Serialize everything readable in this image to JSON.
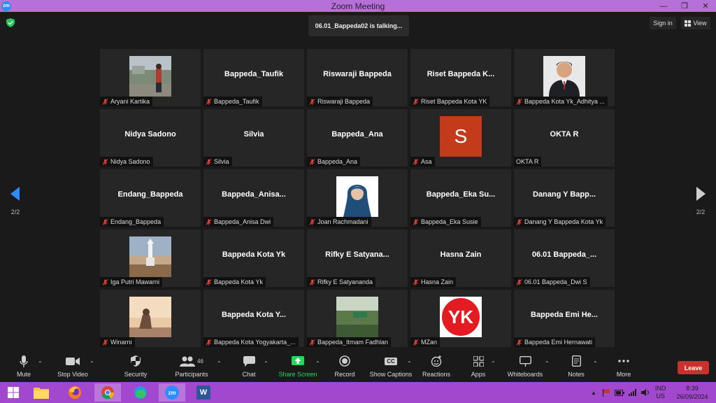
{
  "window": {
    "title": "Zoom Meeting",
    "app_icon": "zm"
  },
  "meeting": {
    "talking_indicator": "06.01_Bappeda02 is talking...",
    "sign_in_label": "Sign in",
    "view_label": "View",
    "page_indicator_left": "2/2",
    "page_indicator_right": "2/2"
  },
  "participants": [
    {
      "display": "photo",
      "label": "Aryani Kartika"
    },
    {
      "display": "name",
      "big_name": "Bappeda_Taufik",
      "label": "Bappeda_Taufik"
    },
    {
      "display": "name",
      "big_name": "Riswaraji Bappeda",
      "label": "Riswaraji Bappeda"
    },
    {
      "display": "name",
      "big_name": "Riset Bappeda K...",
      "label": "Riset Bappeda Kota YK"
    },
    {
      "display": "photo",
      "label": "Bappeda Kota Yk_Adhitya ..."
    },
    {
      "display": "name",
      "big_name": "Nidya Sadono",
      "label": "Nidya Sadono"
    },
    {
      "display": "name",
      "big_name": "Silvia",
      "label": "Silvia"
    },
    {
      "display": "name",
      "big_name": "Bappeda_Ana",
      "label": "Bappeda_Ana"
    },
    {
      "display": "avatar",
      "avatar_letter": "S",
      "label": "Asa"
    },
    {
      "display": "name",
      "big_name": "OKTA R",
      "label": "OKTA R"
    },
    {
      "display": "name",
      "big_name": "Endang_Bappeda",
      "label": "Endang_Bappeda"
    },
    {
      "display": "name",
      "big_name": "Bappeda_Anisa...",
      "label": "Bappeda_Anisa Dwi"
    },
    {
      "display": "photo",
      "label": "Joan Rachmadani"
    },
    {
      "display": "name",
      "big_name": "Bappeda_Eka Su...",
      "label": "Bappeda_Eka Susie"
    },
    {
      "display": "name",
      "big_name": "Danang Y Bapp...",
      "label": "Danang Y Bappeda Kota Yk"
    },
    {
      "display": "photo",
      "label": "Iga Putri Mawarni"
    },
    {
      "display": "name",
      "big_name": "Bappeda Kota Yk",
      "label": "Bappeda Kota Yk"
    },
    {
      "display": "name",
      "big_name": "Rifky E Satyana...",
      "label": "Rifky E Satyananda"
    },
    {
      "display": "name",
      "big_name": "Hasna Zain",
      "label": "Hasna Zain"
    },
    {
      "display": "name",
      "big_name": "06.01 Bappeda_...",
      "label": "06.01 Bappeda_Dwi S"
    },
    {
      "display": "photo",
      "label": "Winarni"
    },
    {
      "display": "name",
      "big_name": "Bappeda Kota Y...",
      "label": "Bappeda Kota Yogyakarta_..."
    },
    {
      "display": "photo",
      "label": "Bappeda_Itmam Fadhlan"
    },
    {
      "display": "photo",
      "logo_text": "YK",
      "label": "MZan"
    },
    {
      "display": "name",
      "big_name": "Bappeda Emi He...",
      "label": "Bappeda Emi Hernawati"
    }
  ],
  "toolbar": {
    "mute": "Mute",
    "stop_video": "Stop Video",
    "security": "Security",
    "participants": "Participants",
    "participants_count": "46",
    "chat": "Chat",
    "share_screen": "Share Screen",
    "record": "Record",
    "show_captions": "Show Captions",
    "captions_icon_text": "CC",
    "reactions": "Reactions",
    "apps": "Apps",
    "whiteboards": "Whiteboards",
    "notes": "Notes",
    "more": "More",
    "leave": "Leave"
  },
  "taskbar": {
    "language_top": "IND",
    "language_bottom": "US",
    "time": "8:39",
    "date": "26/09/2024",
    "zoom_icon_text": "zm",
    "word_icon_text": "W"
  },
  "colors": {
    "titlebar": "#b571d8",
    "taskbar": "#a148cf",
    "share_green": "#23d959",
    "leave_red": "#c9312e",
    "mic_muted_red": "#e0453a",
    "avatar_orange": "#c33b1b",
    "nav_arrow_blue": "#2d8cff"
  }
}
